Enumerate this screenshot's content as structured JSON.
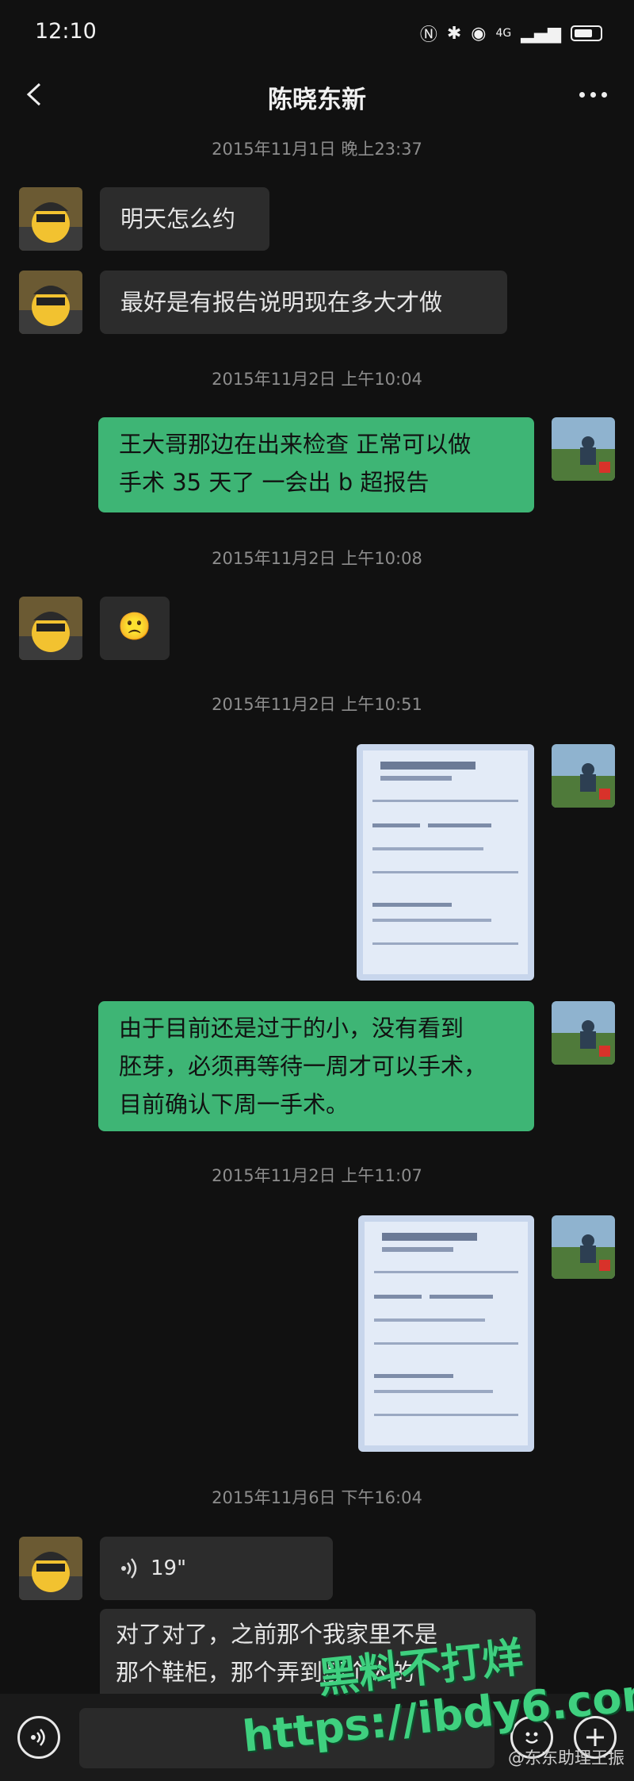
{
  "status_bar": {
    "time": "12:10",
    "network_label": "4G"
  },
  "header": {
    "title": "陈晓东新"
  },
  "messages": [
    {
      "timestamp": "2015年11月1日  晚上23:37"
    },
    {
      "from": "contact",
      "text": "明天怎么约"
    },
    {
      "from": "contact",
      "text": "最好是有报告说明现在多大才做"
    },
    {
      "timestamp": "2015年11月2日  上午10:04"
    },
    {
      "from": "me",
      "lines": [
        "王大哥那边在出来检查  正常可以做",
        "手术  35 天了    一会出 b 超报告"
      ]
    },
    {
      "timestamp": "2015年11月2日  上午10:08"
    },
    {
      "from": "contact",
      "emoji": "🙁"
    },
    {
      "timestamp": "2015年11月2日  上午10:51"
    },
    {
      "from": "me",
      "image": "ultrasound-report-photo"
    },
    {
      "from": "me",
      "lines": [
        "由于目前还是过于的小，没有看到",
        "胚芽，必须再等待一周才可以手术，",
        "目前确认下周一手术。"
      ]
    },
    {
      "timestamp": "2015年11月2日  上午11:07"
    },
    {
      "from": "me",
      "image": "ultrasound-report-photo"
    },
    {
      "timestamp": "2015年11月6日  下午16:04"
    },
    {
      "from": "contact",
      "voice_duration": "19\""
    },
    {
      "from": "contact",
      "lines": [
        "对了对了，之前那个我家里不是",
        "那个鞋柜，那个弄到那个人的"
      ]
    }
  ],
  "watermark": {
    "line1": "黑料不打烊",
    "line2": "https://ibdy6.com"
  },
  "credit": "@东东助理王振",
  "icons": {
    "back": "chevron-left-icon",
    "more": "more-icon",
    "voice_input": "voice-input-icon",
    "emoji": "emoji-icon",
    "add": "plus-icon"
  },
  "colors": {
    "background": "#111111",
    "incoming_bubble": "#2c2c2c",
    "outgoing_bubble": "#3eb575",
    "watermark": "#3fd07f"
  }
}
